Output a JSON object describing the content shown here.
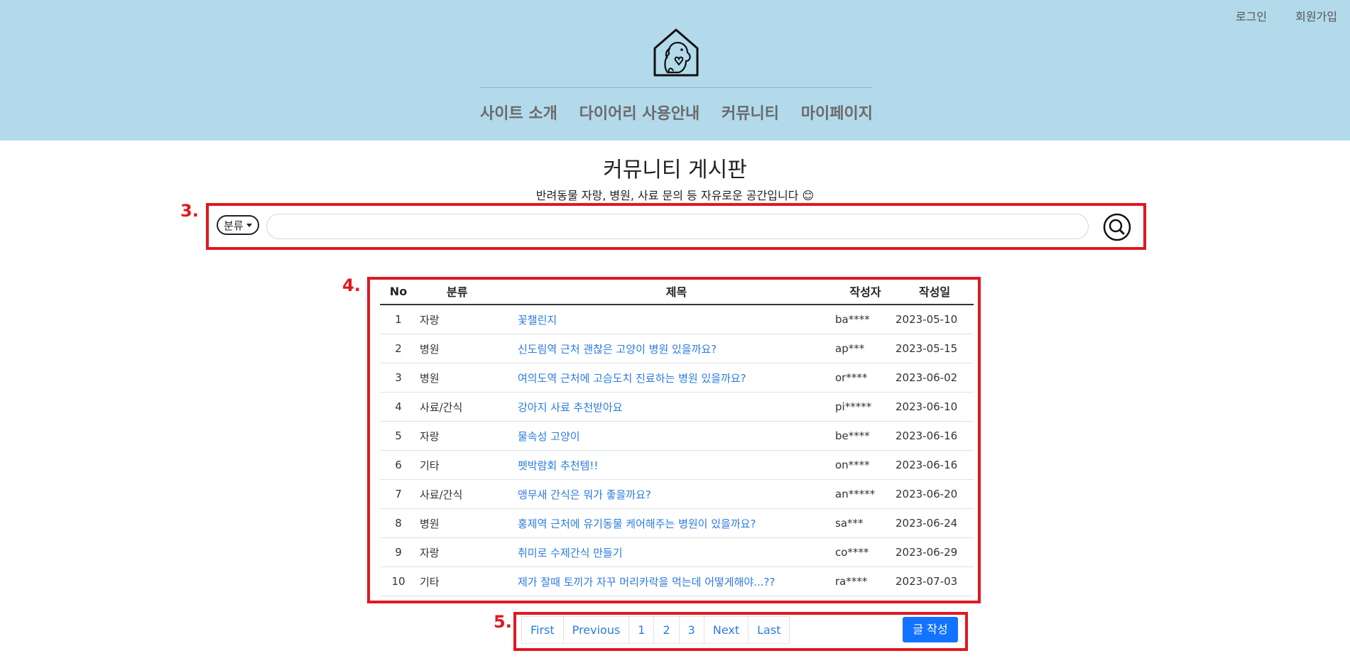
{
  "auth": {
    "login": "로그인",
    "signup": "회원가입"
  },
  "nav": [
    "사이트 소개",
    "다이어리 사용안내",
    "커뮤니티",
    "마이페이지"
  ],
  "page": {
    "title": "커뮤니티 게시판",
    "subtitle": "반려동물 자랑, 병원, 사료 문의 등 자유로운 공간입니다 😊"
  },
  "annotations": {
    "search": "3.",
    "table": "4.",
    "pager": "5."
  },
  "search": {
    "category_label": "분류",
    "query": ""
  },
  "table": {
    "headers": [
      "No",
      "분류",
      "제목",
      "작성자",
      "작성일"
    ],
    "rows": [
      {
        "no": "1",
        "category": "자랑",
        "title": "꽃챌린지",
        "author": "ba****",
        "date": "2023-05-10"
      },
      {
        "no": "2",
        "category": "병원",
        "title": "신도림역 근처 괜찮은 고양이 병원 있을까요?",
        "author": "ap***",
        "date": "2023-05-15"
      },
      {
        "no": "3",
        "category": "병원",
        "title": "여의도역 근처에 고슴도치 진료하는 병원 있을까요?",
        "author": "or****",
        "date": "2023-06-02"
      },
      {
        "no": "4",
        "category": "사료/간식",
        "title": "강아지 사료 추천받아요",
        "author": "pi*****",
        "date": "2023-06-10"
      },
      {
        "no": "5",
        "category": "자랑",
        "title": "물속성 고양이",
        "author": "be****",
        "date": "2023-06-16"
      },
      {
        "no": "6",
        "category": "기타",
        "title": "펫박람회 추천템!!",
        "author": "on****",
        "date": "2023-06-16"
      },
      {
        "no": "7",
        "category": "사료/간식",
        "title": "앵무새 간식은 뭐가 좋을까요?",
        "author": "an*****",
        "date": "2023-06-20"
      },
      {
        "no": "8",
        "category": "병원",
        "title": "홍제역 근처에 유기동물 케어해주는 병원이 있을까요?",
        "author": "sa***",
        "date": "2023-06-24"
      },
      {
        "no": "9",
        "category": "자랑",
        "title": "취미로 수제간식 만들기",
        "author": "co****",
        "date": "2023-06-29"
      },
      {
        "no": "10",
        "category": "기타",
        "title": "제가 잘때 토끼가 자꾸 머리카락을 먹는데 어떻게해야...??",
        "author": "ra****",
        "date": "2023-07-03"
      }
    ]
  },
  "pager": {
    "items": [
      "First",
      "Previous",
      "1",
      "2",
      "3",
      "Next",
      "Last"
    ]
  },
  "write_button": "글 작성",
  "colors": {
    "header_bg": "#b3daeb",
    "link": "#2b7be0",
    "annotation": "#e0181f",
    "primary": "#1273ff"
  }
}
